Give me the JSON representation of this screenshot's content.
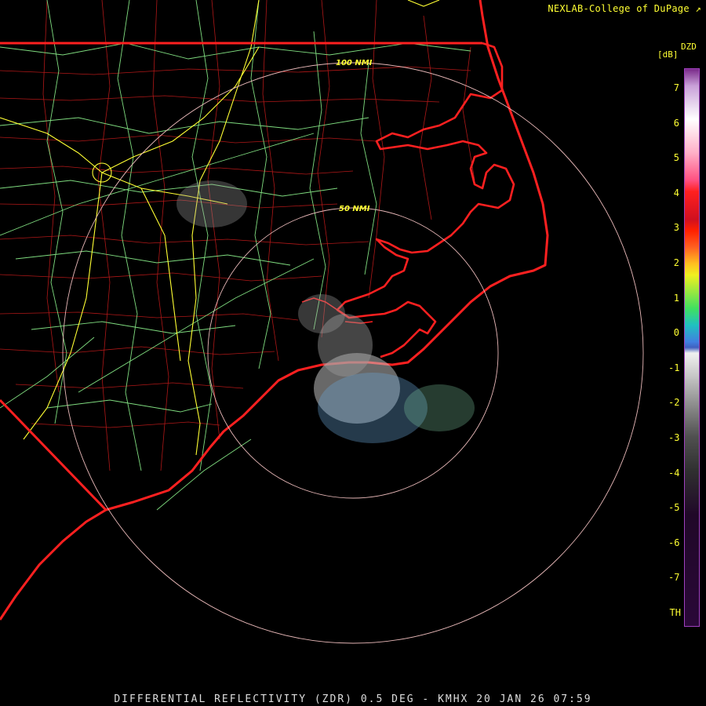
{
  "header": {
    "credit": "NEXLAB-College of DuPage"
  },
  "footer": {
    "caption": "DIFFERENTIAL REFLECTIVITY (ZDR) 0.5 DEG - KMHX 20 JAN 26 07:59"
  },
  "range_rings": {
    "inner_label": "50 NMI",
    "outer_label": "100 NMI"
  },
  "colorbar": {
    "product": "DZD",
    "unit": "[dB]",
    "ticks": [
      "7",
      "6",
      "5",
      "4",
      "3",
      "2",
      "1",
      "0",
      "-1",
      "-2",
      "-3",
      "-4",
      "-5",
      "-6",
      "-7",
      "TH"
    ]
  },
  "colors": {
    "state_borders": "#ff2020",
    "county_borders": "#c01818",
    "highways": "#80e080",
    "interstates": "#ffff33",
    "range_rings": "#e8b8b8"
  }
}
